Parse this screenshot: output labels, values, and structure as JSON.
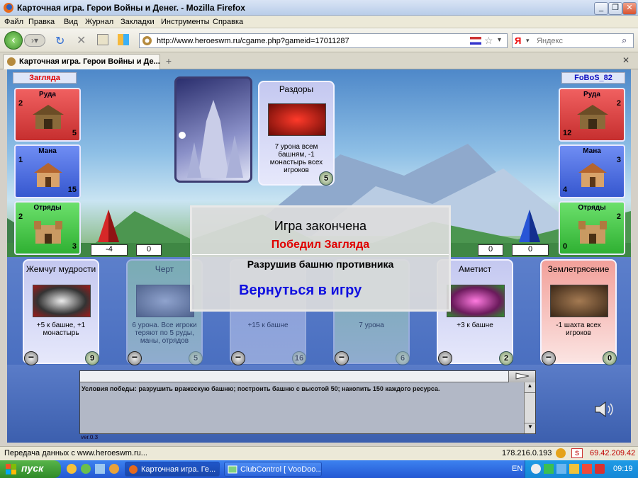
{
  "window": {
    "title": "Карточная игра. Герои Войны и Денег. - Mozilla Firefox"
  },
  "menu": [
    "Файл",
    "Правка",
    "Вид",
    "Журнал",
    "Закладки",
    "Инструменты",
    "Справка"
  ],
  "address": {
    "url": "http://www.heroeswm.ru/cgame.php?gameid=17011287"
  },
  "search": {
    "placeholder": "Яндекс"
  },
  "tab": {
    "label": "Карточная игра. Герои Войны и Де...",
    "new_tab": "+"
  },
  "players": {
    "left": "Загляда",
    "right": "FoBoS_82"
  },
  "left_resources": [
    {
      "name": "Руда",
      "income": "2",
      "amount": "5"
    },
    {
      "name": "Мана",
      "income": "1",
      "amount": "15"
    },
    {
      "name": "Отряды",
      "income": "2",
      "amount": "3"
    }
  ],
  "right_resources": [
    {
      "name": "Руда",
      "income": "2",
      "amount": "12"
    },
    {
      "name": "Мана",
      "income": "3",
      "amount": "4"
    },
    {
      "name": "Отряды",
      "income": "2",
      "amount": "0"
    }
  ],
  "left_tower": {
    "tower": "-4",
    "wall": "0"
  },
  "right_tower": {
    "tower": "0",
    "wall": "0"
  },
  "played_card": {
    "name": "Раздоры",
    "desc": "7 урона всем башням, -1 монастырь всех игроков",
    "cost": "5"
  },
  "hand": [
    {
      "name": "Жемчуг мудрости",
      "desc": "+5 к башне, +1 монастырь",
      "cost": "9"
    },
    {
      "name": "Черт",
      "desc": "6 урона. Все игроки теряют по 5 руды, маны, отрядов",
      "cost": "5"
    },
    {
      "name": "",
      "desc": "+15 к башне",
      "cost": "16"
    },
    {
      "name": "",
      "desc": "7 урона",
      "cost": "6"
    },
    {
      "name": "Аметист",
      "desc": "+3 к башне",
      "cost": "2"
    },
    {
      "name": "Землетрясение",
      "desc": "-1 шахта всех игроков",
      "cost": "0"
    }
  ],
  "dialog": {
    "title": "Игра закончена",
    "winner": "Победил Загляда",
    "reason": "Разрушив башню противника",
    "return": "Вернуться в игру"
  },
  "log": {
    "text": "Условия победы: разрушить вражескую башню; построить башню с высотой 50; накопить 150 каждого ресурса."
  },
  "version": "ver.0.3",
  "status": {
    "text": "Передача данных с www.heroeswm.ru...",
    "ip": "178.216.0.193",
    "ip2": "69.42.209.42"
  },
  "taskbar": {
    "start": "пуск",
    "tasks": [
      "Карточная игра. Ге...",
      "ClubControl [ VooDoo..."
    ],
    "lang": "EN",
    "time": "09:19"
  },
  "colors": {
    "ore": "#e53b3b",
    "mana": "#3b5fe5",
    "troops": "#34c23a",
    "title_red": "#e00000",
    "link_blue": "#1010e0"
  }
}
